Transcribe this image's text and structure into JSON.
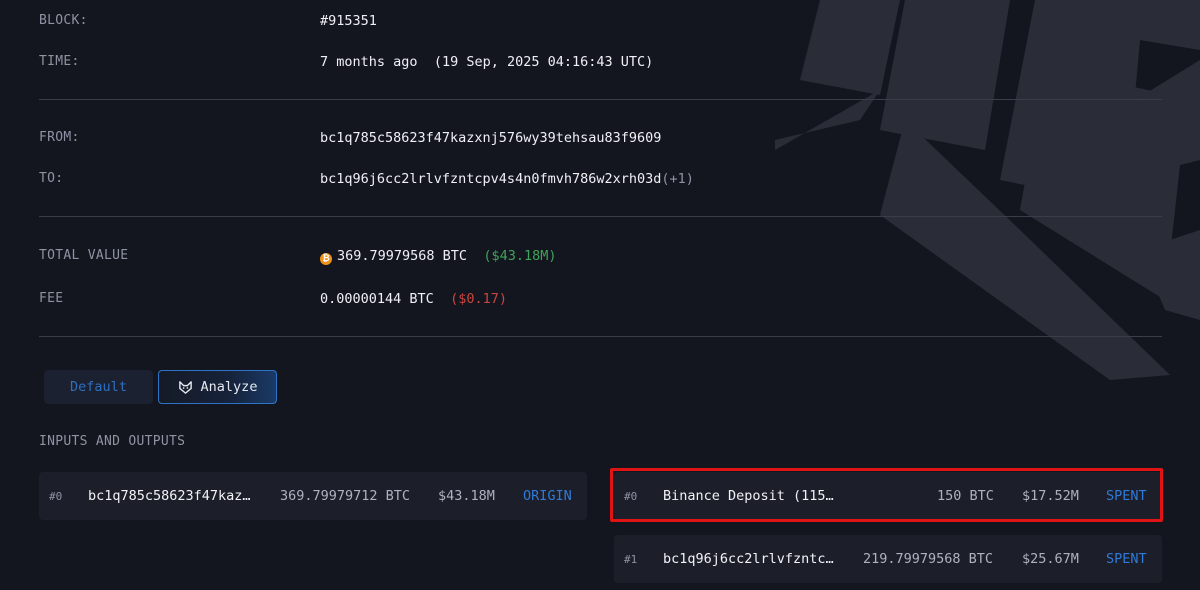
{
  "details": {
    "block": {
      "label": "BLOCK:",
      "value": "#915351"
    },
    "time": {
      "label": "TIME:",
      "relative": "7 months ago",
      "absolute": "(19 Sep, 2025 04:16:43 UTC)"
    },
    "from": {
      "label": "FROM:",
      "value": "bc1q785c58623f47kazxnj576wy39tehsau83f9609"
    },
    "to": {
      "label": "TO:",
      "value": "bc1q96j6cc2lrlvfzntcpv4s4n0fmvh786w2xrh03d",
      "extra": "(+1)"
    },
    "total_value": {
      "label": "TOTAL VALUE",
      "btc": "369.79979568 BTC",
      "usd": "($43.18M)"
    },
    "fee": {
      "label": "FEE",
      "btc": "0.00000144 BTC",
      "usd": "($0.17)"
    }
  },
  "tabs": {
    "default_label": "Default",
    "analyze_label": "Analyze",
    "active": "Analyze"
  },
  "io": {
    "title": "INPUTS AND OUTPUTS",
    "inputs": [
      {
        "index": "#0",
        "address": "bc1q785c58623f47kaz…",
        "amount": "369.79979712 BTC",
        "usd": "$43.18M",
        "status": "ORIGIN"
      }
    ],
    "outputs": [
      {
        "index": "#0",
        "address": "Binance Deposit (115…",
        "amount": "150 BTC",
        "usd": "$17.52M",
        "status": "SPENT"
      },
      {
        "index": "#1",
        "address": "bc1q96j6cc2lrlvfzntc…",
        "amount": "219.79979568 BTC",
        "usd": "$25.67M",
        "status": "SPENT"
      }
    ]
  },
  "colors": {
    "background": "#14161f",
    "accent_blue": "#2f7ad8",
    "positive": "#3fa35a",
    "negative": "#c8453f",
    "highlight": "#e01414",
    "btc_orange": "#f0921a"
  }
}
